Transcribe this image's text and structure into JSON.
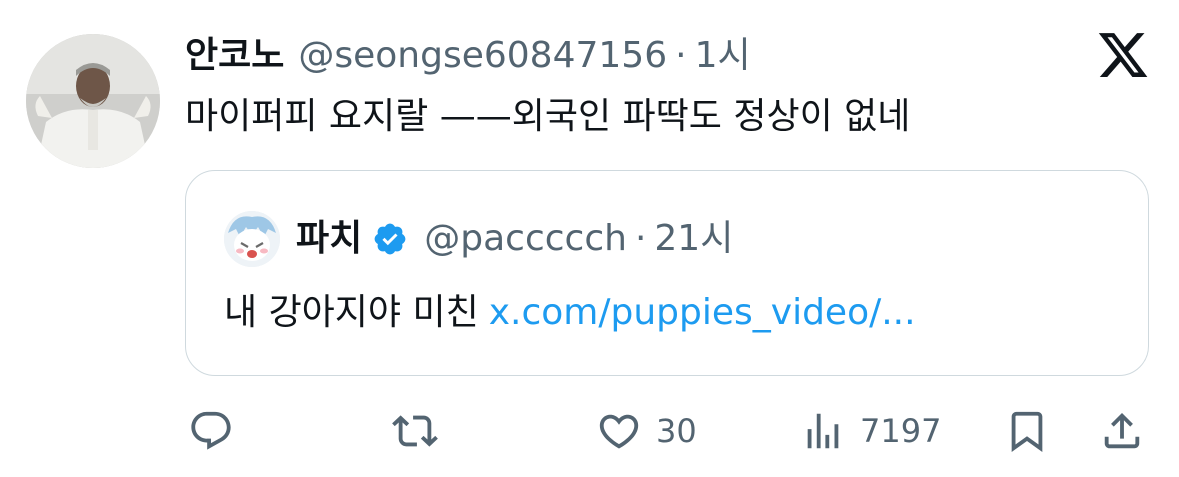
{
  "tweet": {
    "author_name": "안코노",
    "handle": "@seongse60847156",
    "separator": "·",
    "time": "1시",
    "text": "마이퍼피 요지랄 ——외국인 파딱도 정상이 없네"
  },
  "quoted": {
    "author_name": "파치",
    "handle": "@paccccch",
    "separator": "·",
    "time": "21시",
    "text": "내 강아지야 미친",
    "link": "x.com/puppies_video/..."
  },
  "actions": {
    "likes": "30",
    "views": "7197"
  },
  "icons": {
    "logo": "x-logo-icon",
    "verified": "verified-badge-icon",
    "reply": "reply-icon",
    "retweet": "retweet-icon",
    "like": "heart-icon",
    "views": "views-icon",
    "bookmark": "bookmark-icon",
    "share": "share-icon"
  },
  "colors": {
    "link": "#1d9bf0",
    "verified": "#1d9bf0",
    "secondary_text": "#536471",
    "border": "#cfd9de"
  }
}
